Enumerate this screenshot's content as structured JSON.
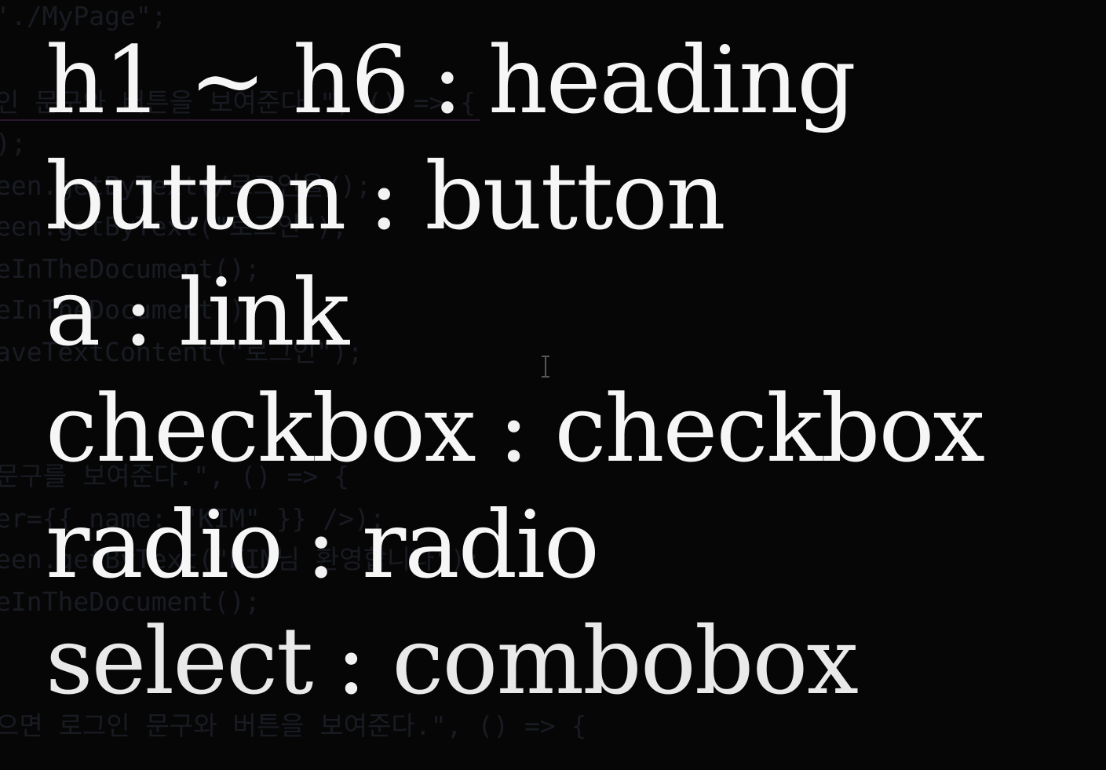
{
  "background_code": [
    "'./MyPage\";",
    "인 문구와 버튼을 보여준다.\", () => {",
    ");",
    "een.getByText(/로그인을/);",
    "een.getByText(\"로그인\");",
    "eInTheDocument();",
    "eInTheDocument();",
    "aveTextContent(\"로그인\");",
    "문구를 보여준다.\", () => {",
    "er={{ name: \"KIM\" }} />);",
    "een.getByText(\"KIM님 환영합니다\");",
    "eInTheDocument();",
    "으면 로그인 문구와 버튼을 보여준다.\", () => {"
  ],
  "mappings": [
    {
      "element": "h1 ~ h6",
      "separator": ":",
      "role": "heading"
    },
    {
      "element": "button",
      "separator": ":",
      "role": "button"
    },
    {
      "element": "a",
      "separator": ":",
      "role": "link"
    },
    {
      "element": "checkbox",
      "separator": ":",
      "role": "checkbox"
    },
    {
      "element": "radio",
      "separator": ":",
      "role": "radio"
    },
    {
      "element": "select",
      "separator": ":",
      "role": "combobox"
    }
  ],
  "cursor_icon": "text-cursor-icon"
}
